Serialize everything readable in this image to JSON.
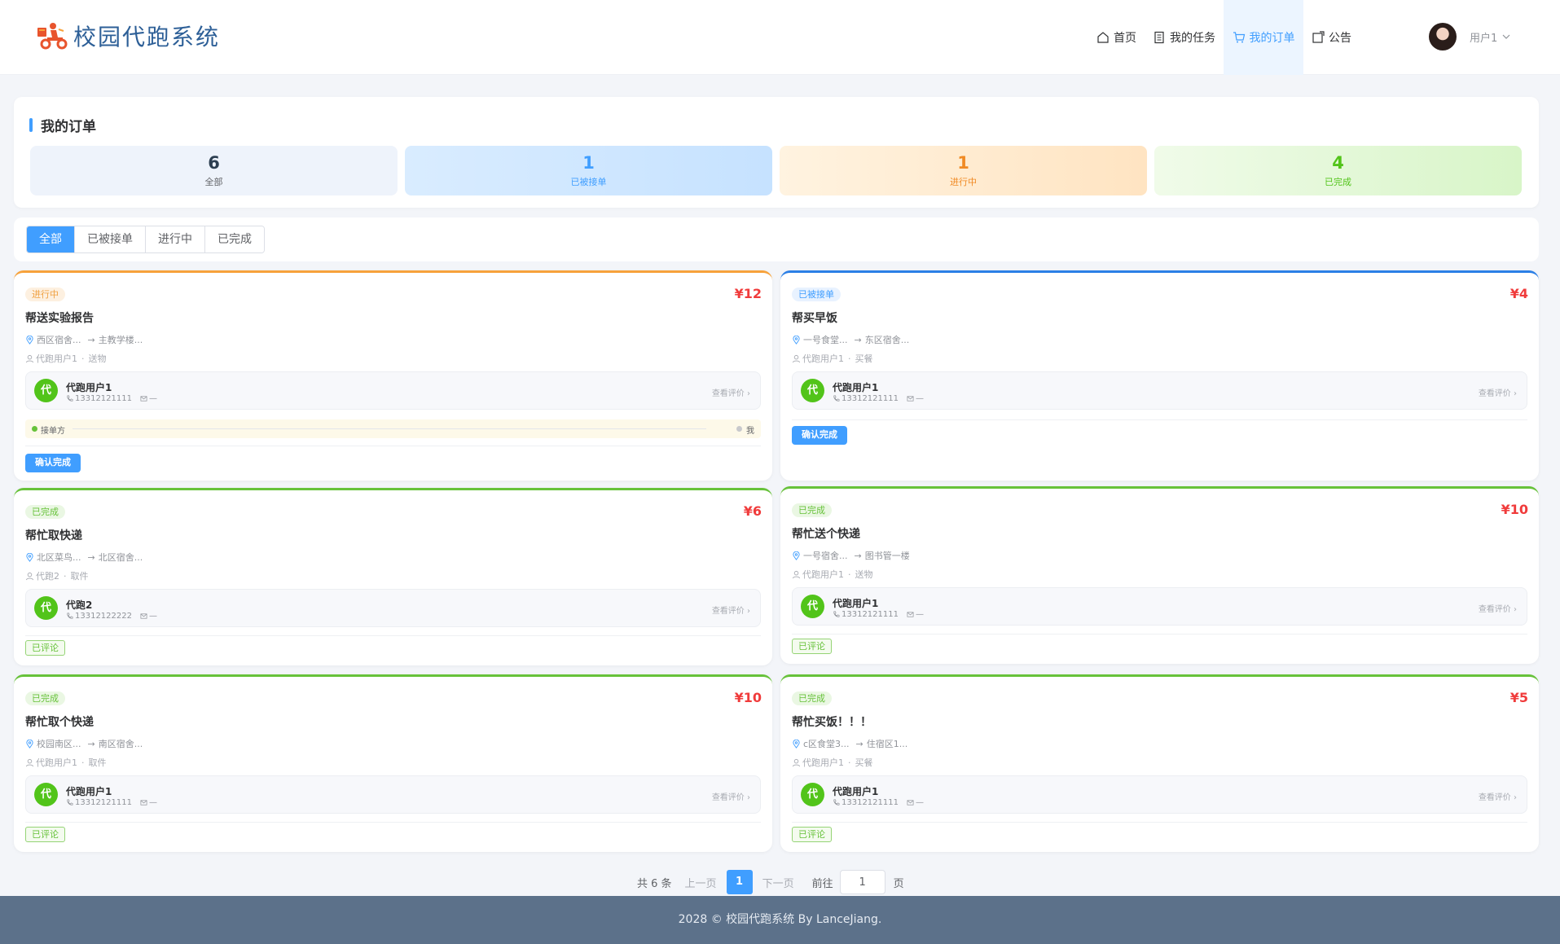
{
  "app": {
    "name": "校园代跑系统"
  },
  "nav": [
    {
      "label": "首页",
      "icon": "home-icon"
    },
    {
      "label": "我的任务",
      "icon": "document-icon"
    },
    {
      "label": "我的订单",
      "icon": "cart-icon"
    },
    {
      "label": "公告",
      "icon": "notice-icon"
    }
  ],
  "user": {
    "name": "用户1"
  },
  "summary": {
    "title": "我的订单",
    "stats": [
      {
        "value": "6",
        "label": "全部"
      },
      {
        "value": "1",
        "label": "已被接单"
      },
      {
        "value": "1",
        "label": "进行中"
      },
      {
        "value": "4",
        "label": "已完成"
      }
    ]
  },
  "filters": {
    "tabs": [
      "全部",
      "已被接单",
      "进行中",
      "已完成"
    ],
    "active": "全部"
  },
  "orders": [
    {
      "status": "进行中",
      "price": "¥12",
      "title": "帮送实验报告",
      "from": "西区宿舍...",
      "to": "主教学楼...",
      "runner_label": "代跑用户1",
      "type": "送物",
      "runner": {
        "avatar": "代",
        "name": "代跑用户1",
        "phone": "13312121111",
        "email": "—"
      },
      "review_link": "查看评价 ›",
      "progress": {
        "start": "接单方",
        "end": "我"
      },
      "action": "确认完成"
    },
    {
      "status": "已被接单",
      "price": "¥4",
      "title": "帮买早饭",
      "from": "一号食堂...",
      "to": "东区宿舍...",
      "runner_label": "代跑用户1",
      "type": "买餐",
      "runner": {
        "avatar": "代",
        "name": "代跑用户1",
        "phone": "13312121111",
        "email": "—"
      },
      "review_link": "查看评价 ›",
      "action": "确认完成"
    },
    {
      "status": "已完成",
      "price": "¥6",
      "title": "帮忙取快递",
      "from": "北区菜鸟...",
      "to": "北区宿舍...",
      "runner_label": "代跑2",
      "type": "取件",
      "runner": {
        "avatar": "代",
        "name": "代跑2",
        "phone": "13312122222",
        "email": "—"
      },
      "review_link": "查看评价 ›",
      "tag": "已评论"
    },
    {
      "status": "已完成",
      "price": "¥10",
      "title": "帮忙送个快递",
      "from": "一号宿舍...",
      "to": "图书管一楼",
      "runner_label": "代跑用户1",
      "type": "送物",
      "runner": {
        "avatar": "代",
        "name": "代跑用户1",
        "phone": "13312121111",
        "email": "—"
      },
      "review_link": "查看评价 ›",
      "tag": "已评论"
    },
    {
      "status": "已完成",
      "price": "¥10",
      "title": "帮忙取个快递",
      "from": "校园南区...",
      "to": "南区宿舍...",
      "runner_label": "代跑用户1",
      "type": "取件",
      "runner": {
        "avatar": "代",
        "name": "代跑用户1",
        "phone": "13312121111",
        "email": "—"
      },
      "review_link": "查看评价 ›",
      "tag": "已评论"
    },
    {
      "status": "已完成",
      "price": "¥5",
      "title": "帮忙买饭！！！",
      "from": "c区食堂3...",
      "to": "住宿区1...",
      "runner_label": "代跑用户1",
      "type": "买餐",
      "runner": {
        "avatar": "代",
        "name": "代跑用户1",
        "phone": "13312121111",
        "email": "—"
      },
      "review_link": "查看评价 ›",
      "tag": "已评论"
    }
  ],
  "pagination": {
    "total": "共 6 条",
    "prev": "上一页",
    "current": "1",
    "next": "下一页",
    "goto": "前往",
    "goto_value": "1",
    "unit": "页"
  },
  "footer": {
    "text": "2028 © 校园代跑系统 By LanceJiang."
  },
  "colors": {
    "accent": "#409eff",
    "price": "#f03b3b",
    "orange": "#f7a23b",
    "blue": "#2b7fe6",
    "green": "#67c23a",
    "footer_bg": "#5c718a"
  }
}
